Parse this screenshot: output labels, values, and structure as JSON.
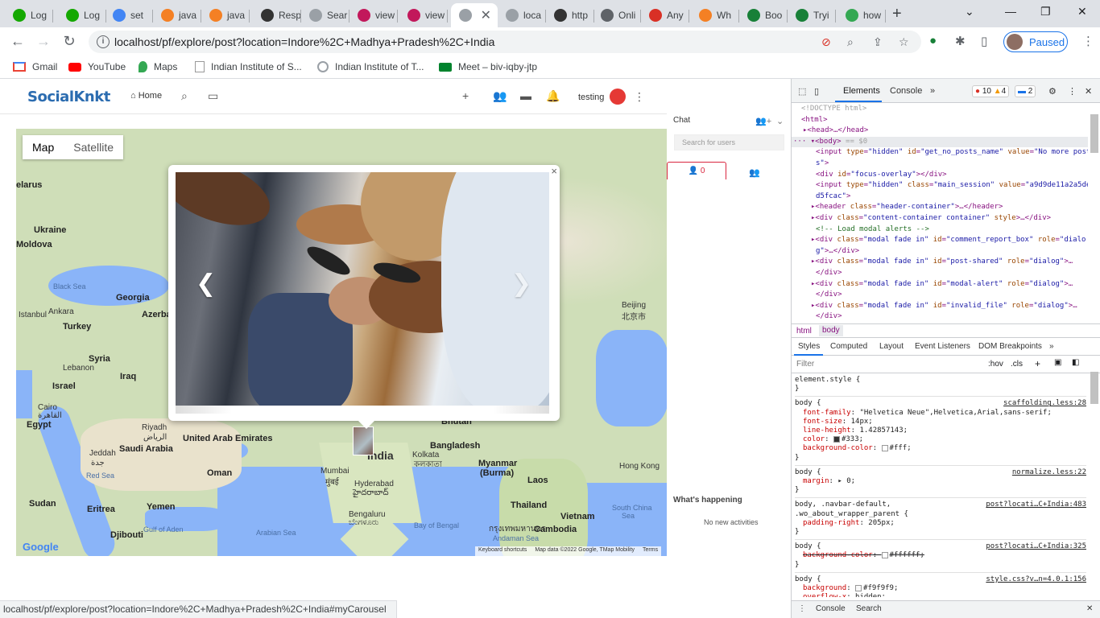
{
  "tabs": [
    {
      "label": "Log",
      "icon": "upwork-icon",
      "color": "#14a800"
    },
    {
      "label": "Log",
      "icon": "upwork-icon",
      "color": "#14a800"
    },
    {
      "label": "set",
      "icon": "google-icon",
      "color": "#4285f4"
    },
    {
      "label": "java",
      "icon": "stackoverflow-icon",
      "color": "#f48024"
    },
    {
      "label": "java",
      "icon": "stackoverflow-icon",
      "color": "#f48024"
    },
    {
      "label": "Resp",
      "icon": "codepen-icon",
      "color": "#333333"
    },
    {
      "label": "Sear",
      "icon": "page-icon",
      "color": "#9aa0a6"
    },
    {
      "label": "view",
      "icon": "mpdf-icon",
      "color": "#c2185b"
    },
    {
      "label": "view",
      "icon": "mpdf-icon",
      "color": "#c2185b"
    },
    {
      "label": "",
      "icon": "page-icon",
      "color": "#9aa0a6",
      "active": true
    },
    {
      "label": "loca",
      "icon": "page-icon",
      "color": "#9aa0a6"
    },
    {
      "label": "http",
      "icon": "pinwheel-icon",
      "color": "#333333"
    },
    {
      "label": "Onli",
      "icon": "globe-icon",
      "color": "#5f6368"
    },
    {
      "label": "Any",
      "icon": "gear-icon",
      "color": "#d93025"
    },
    {
      "label": "Wh",
      "icon": "stackoverflow-icon",
      "color": "#f48024"
    },
    {
      "label": "Boo",
      "icon": "w-icon",
      "color": "#188038"
    },
    {
      "label": "Tryi",
      "icon": "w-icon",
      "color": "#188038"
    },
    {
      "label": "how",
      "icon": "network-icon",
      "color": "#34a853"
    }
  ],
  "address": {
    "url": "localhost/pf/explore/post?location=Indore%2C+Madhya+Pradesh%2C+India",
    "profile_label": "Paused"
  },
  "bookmarks": [
    {
      "label": "Gmail",
      "icon": "gmail-icon"
    },
    {
      "label": "YouTube",
      "icon": "youtube-icon"
    },
    {
      "label": "Maps",
      "icon": "maps-icon"
    },
    {
      "label": "Indian Institute of S...",
      "icon": "page-icon"
    },
    {
      "label": "Indian Institute of T...",
      "icon": "page-icon"
    },
    {
      "label": "Meet – biv-iqby-jtp",
      "icon": "meet-icon"
    }
  ],
  "site": {
    "logo": "SocialKnkt",
    "home": "Home",
    "username": "testing"
  },
  "map": {
    "map_btn": "Map",
    "satellite_btn": "Satellite",
    "labels": {
      "belarus": "elarus",
      "ukraine": "Ukraine",
      "moldova": "Moldova",
      "black_sea": "Black Sea",
      "georgia": "Georgia",
      "azerbaijan": "Azerba",
      "istanbul": "Istanbul",
      "ankara": "Ankara",
      "turkey": "Turkey",
      "syria": "Syria",
      "lebanon": "Lebanon",
      "iraq": "Iraq",
      "israel": "Israel",
      "cairo": "Cairo",
      "cairo_ar": "القاهرة",
      "egypt": "Egypt",
      "riyadh": "Riyadh",
      "riyadh_ar": "الرياض",
      "uae": "United Arab Emirates",
      "jeddah": "Jeddah",
      "jeddah_ar": "جدة",
      "saudi": "Saudi Arabia",
      "oman": "Oman",
      "red_sea": "Red Sea",
      "sudan": "Sudan",
      "eritrea": "Eritrea",
      "yemen": "Yemen",
      "gulf_aden": "Gulf of Aden",
      "djibouti": "Djibouti",
      "arabian_sea": "Arabian Sea",
      "india": "India",
      "mumbai": "Mumbai",
      "mumbai_local": "मुंबई",
      "hyderabad": "Hyderabad",
      "hyderabad_local": "హైదరాబాద్",
      "bengaluru": "Bengaluru",
      "bengaluru_local": "ಬೆಂಗಳೂರು",
      "bhutan": "Bhutan",
      "bangladesh": "Bangladesh",
      "kolkata": "Kolkata",
      "kolkata_local": "কলকাতা",
      "bay_bengal": "Bay of Bengal",
      "myanmar": "Myanmar",
      "burma": "(Burma)",
      "laos": "Laos",
      "thailand": "Thailand",
      "bangkok_local": "กรุงเทพมหานคร",
      "vietnam": "Vietnam",
      "cambodia": "Cambodia",
      "andaman": "Andaman Sea",
      "hong_kong": "Hong Kong",
      "beijing": "Beijing",
      "beijing_local": "北京市",
      "south_china": "South China",
      "south_china2": "Sea"
    },
    "google": "Google",
    "footer": [
      "Keyboard shortcuts",
      "Map data ©2022 Google, TMap Mobility",
      "Terms"
    ]
  },
  "chat": {
    "title": "Chat",
    "search_placeholder": "Search for users",
    "online_count": "0",
    "whats_happening": "What's happening",
    "no_activities": "No new activities"
  },
  "status_url": "localhost/pf/explore/post?location=Indore%2C+Madhya+Pradesh%2C+India#myCarousel",
  "devtools": {
    "tabs": [
      "Elements",
      "Console"
    ],
    "errors": "10",
    "warnings": "4",
    "messages": "2",
    "crumbs": [
      "html",
      "body"
    ],
    "style_tabs": [
      "Styles",
      "Computed",
      "Layout",
      "Event Listeners",
      "DOM Breakpoints"
    ],
    "filter_placeholder": "Filter",
    "hov": ":hov",
    "cls": ".cls",
    "drawer_tabs": [
      "Console",
      "Search"
    ]
  }
}
